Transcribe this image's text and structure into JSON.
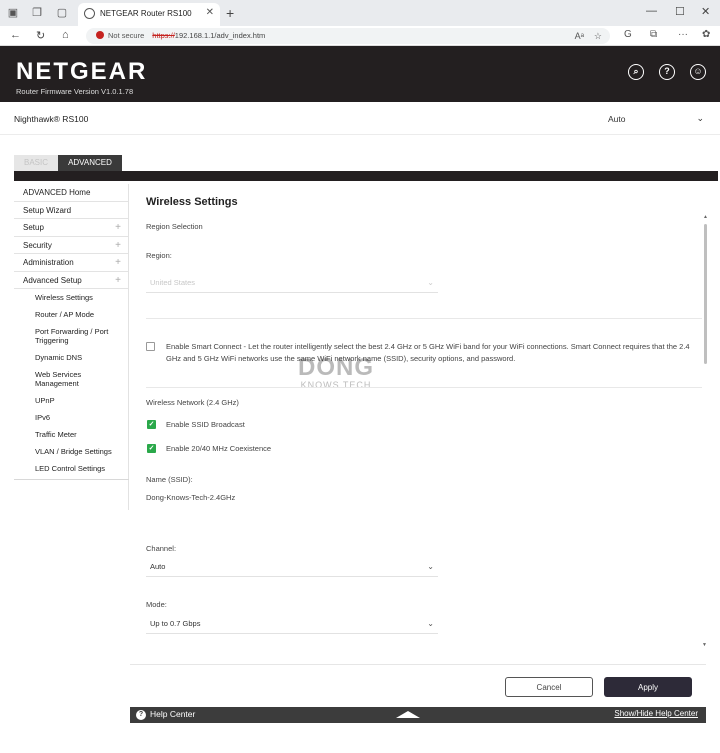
{
  "browser": {
    "tab_title": "NETGEAR Router RS100",
    "security_label": "Not secure",
    "url_scheme": "https://",
    "url_rest": "192.168.1.1/adv_index.htm"
  },
  "header": {
    "logo": "NETGEAR",
    "firmware": "Router Firmware Version V1.0.1.78",
    "model": "Nighthawk® RS100",
    "language": "Auto"
  },
  "mode_tabs": {
    "basic": "BASIC",
    "advanced": "ADVANCED"
  },
  "sidebar": {
    "items": [
      {
        "label": "ADVANCED Home",
        "expandable": false
      },
      {
        "label": "Setup Wizard",
        "expandable": false
      },
      {
        "label": "Setup",
        "expandable": true
      },
      {
        "label": "Security",
        "expandable": true
      },
      {
        "label": "Administration",
        "expandable": true
      },
      {
        "label": "Advanced Setup",
        "expandable": true
      }
    ],
    "subitems": [
      "Wireless Settings",
      "Router / AP Mode",
      "Port Forwarding / Port Triggering",
      "Dynamic DNS",
      "Web Services Management",
      "UPnP",
      "IPv6",
      "Traffic Meter",
      "VLAN / Bridge Settings",
      "LED Control Settings"
    ]
  },
  "main": {
    "title": "Wireless Settings",
    "region_selection": "Region Selection",
    "region_label": "Region:",
    "region_value": "United States",
    "smart_connect_text": "Enable Smart Connect - Let the router intelligently select the best 2.4 GHz or 5 GHz WiFi band for your WiFi connections. Smart Connect requires that the 2.4 GHz and 5 GHz WiFi networks use the same WiFi network name (SSID), security options, and password.",
    "smart_connect_checked": false,
    "network_label": "Wireless Network (2.4 GHz)",
    "ssid_broadcast_label": "Enable SSID Broadcast",
    "ssid_broadcast_checked": true,
    "coexistence_label": "Enable 20/40 MHz Coexistence",
    "coexistence_checked": true,
    "ssid_label": "Name (SSID):",
    "ssid_value": "Dong-Knows-Tech-2.4GHz",
    "channel_label": "Channel:",
    "channel_value": "Auto",
    "mode_label": "Mode:",
    "mode_value": "Up to 0.7 Gbps"
  },
  "buttons": {
    "cancel": "Cancel",
    "apply": "Apply"
  },
  "help": {
    "title": "Help Center",
    "toggle": "Show/Hide Help Center"
  },
  "watermark": {
    "line1": "DONG",
    "line2": "KNOWS TECH"
  },
  "colors": {
    "header_bg": "#231f20",
    "check_green": "#2aa84a",
    "apply_bg": "#2d2a38",
    "insecure_red": "#c5221f"
  }
}
